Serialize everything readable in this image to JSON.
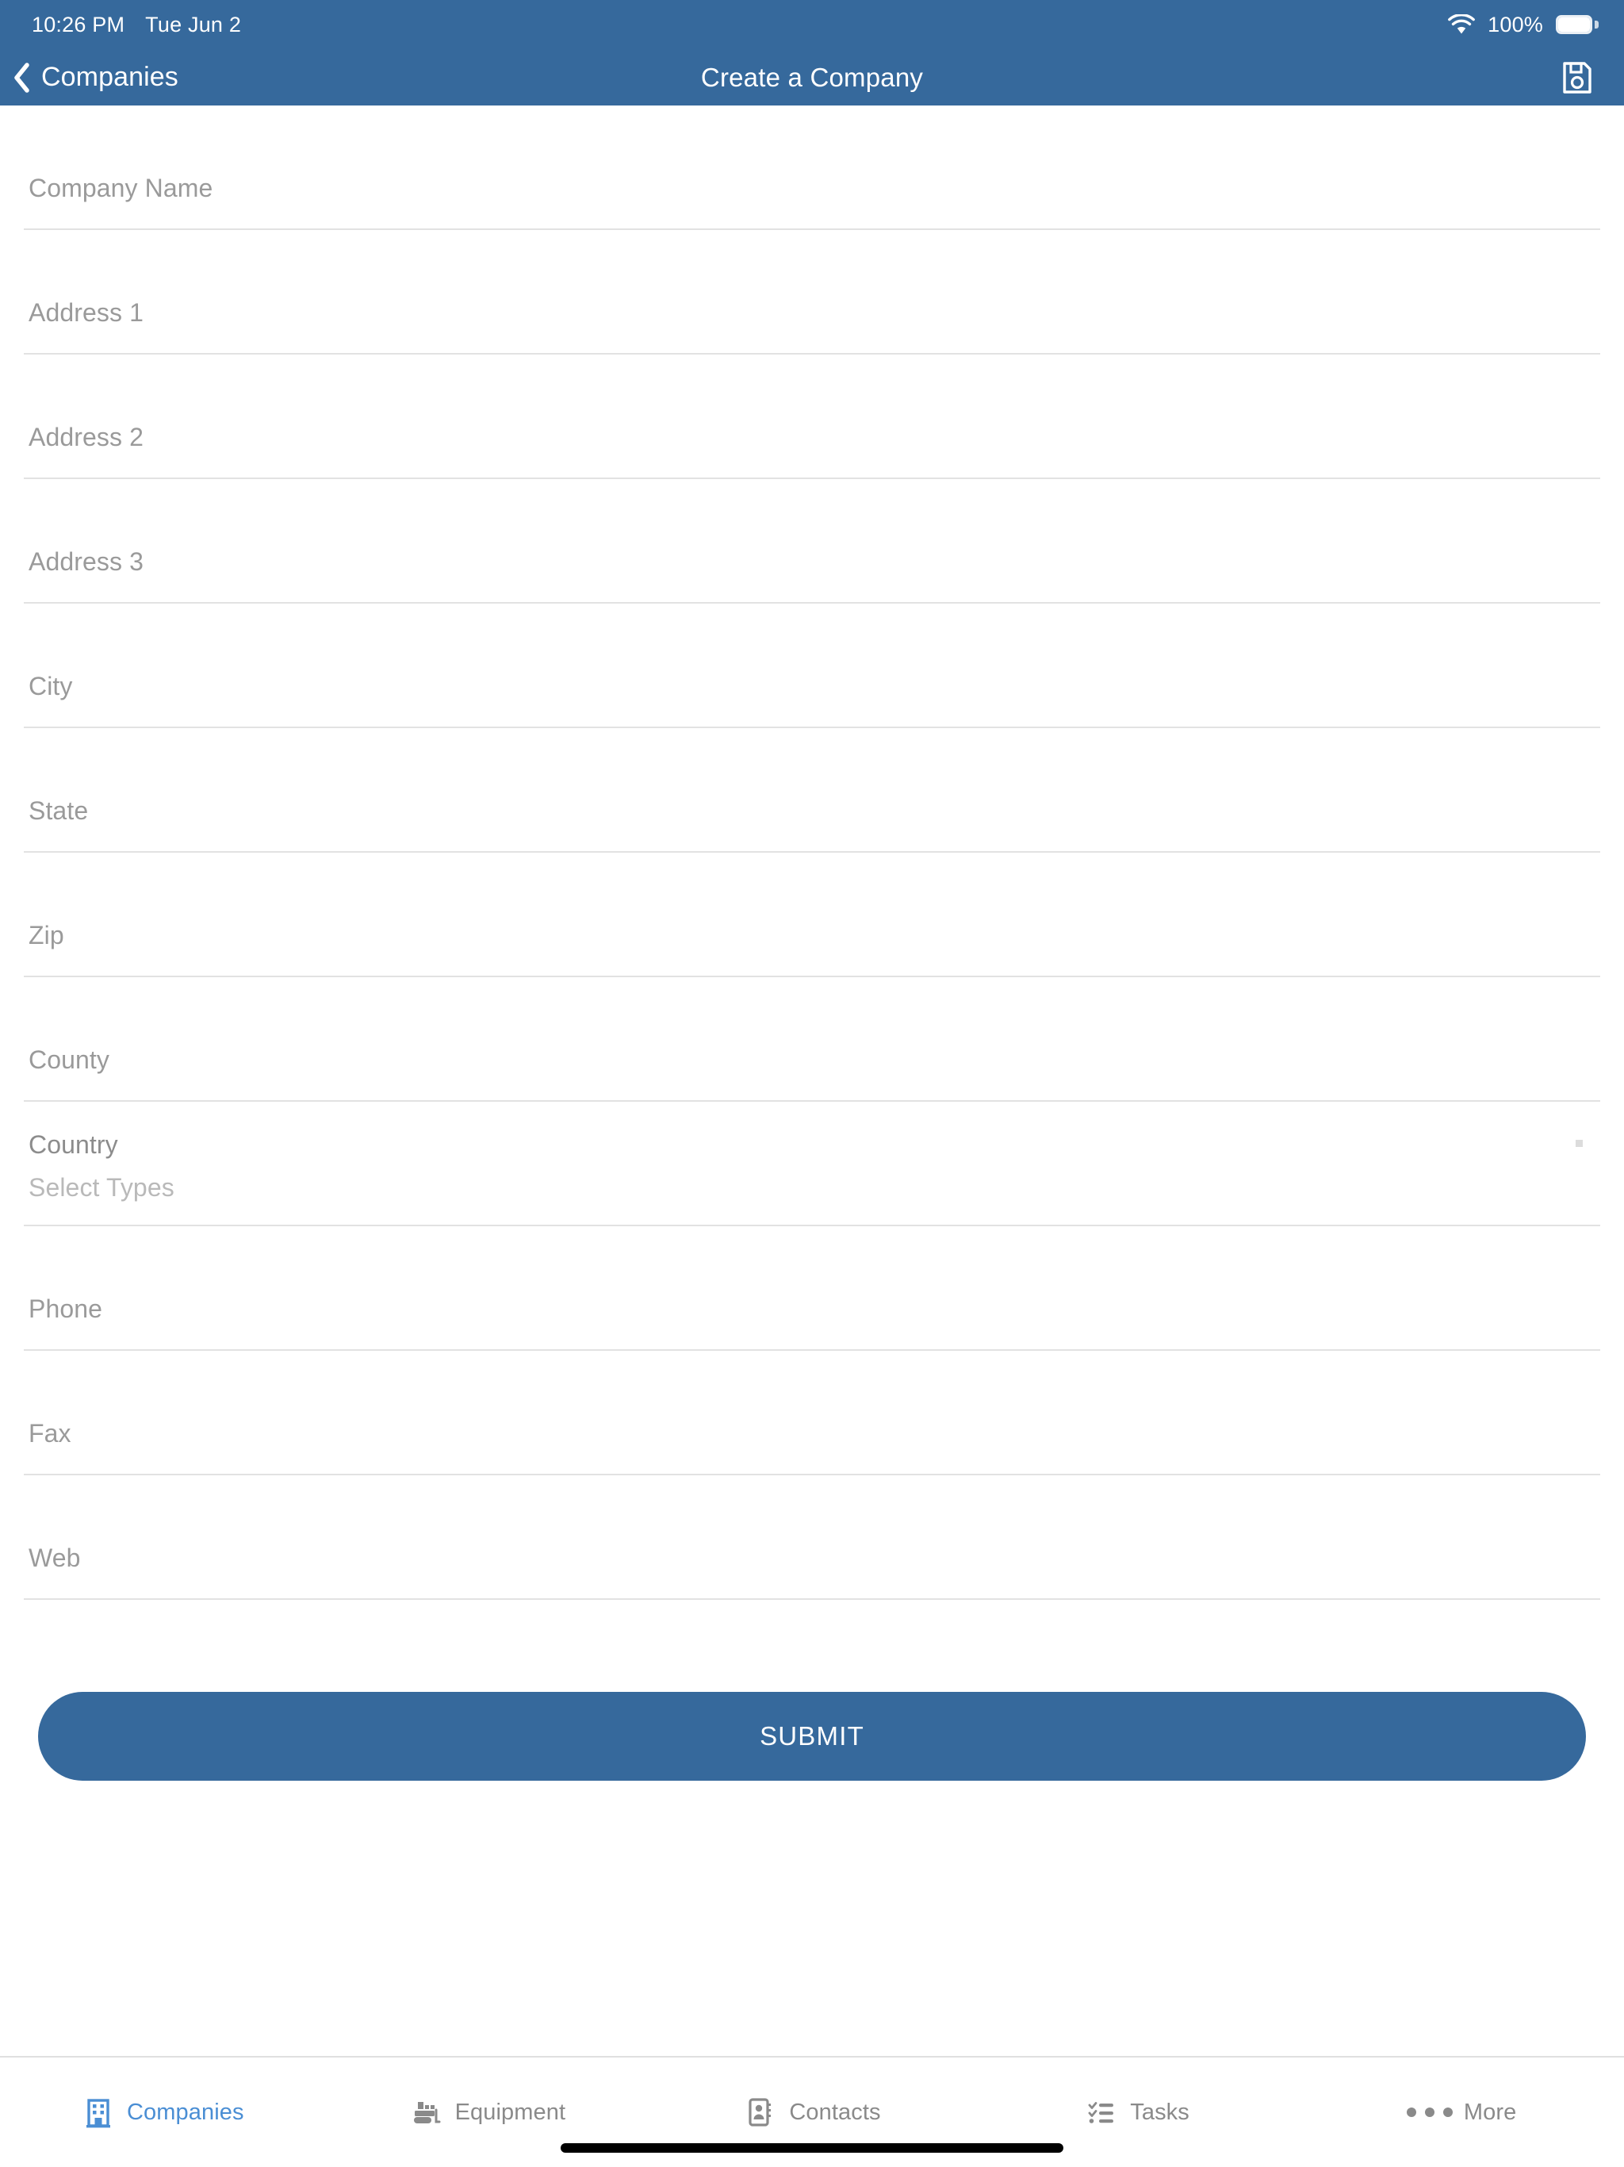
{
  "theme": {
    "brand_blue": "#36699c",
    "active_tab_blue": "#4a8ed4",
    "placeholder_gray": "#9a9a9a",
    "rule_gray": "#e2e2e2",
    "inactive_tab_gray": "#8a8a8a"
  },
  "status_bar": {
    "time": "10:26 PM",
    "date": "Tue Jun 2",
    "wifi_icon": "wifi-icon",
    "battery_percent": "100%",
    "battery_icon": "battery-full-icon"
  },
  "nav_bar": {
    "back_icon": "chevron-left-icon",
    "back_label": "Companies",
    "title": "Create a Company",
    "save_icon": "floppy-disk-save-icon"
  },
  "form": {
    "fields": [
      {
        "name": "company-name",
        "placeholder": "Company Name",
        "value": ""
      },
      {
        "name": "address-1",
        "placeholder": "Address 1",
        "value": ""
      },
      {
        "name": "address-2",
        "placeholder": "Address 2",
        "value": ""
      },
      {
        "name": "address-3",
        "placeholder": "Address 3",
        "value": ""
      },
      {
        "name": "city",
        "placeholder": "City",
        "value": ""
      },
      {
        "name": "state",
        "placeholder": "State",
        "value": ""
      },
      {
        "name": "zip",
        "placeholder": "Zip",
        "value": ""
      },
      {
        "name": "county",
        "placeholder": "County",
        "value": ""
      }
    ],
    "country_row": {
      "label": "Country",
      "types_placeholder": "Select Types",
      "caret_icon": "dropdown-marker-icon"
    },
    "contact_fields": [
      {
        "name": "phone",
        "placeholder": "Phone",
        "value": ""
      },
      {
        "name": "fax",
        "placeholder": "Fax",
        "value": ""
      },
      {
        "name": "web",
        "placeholder": "Web",
        "value": ""
      }
    ],
    "submit_label": "SUBMIT"
  },
  "tab_bar": {
    "tabs": [
      {
        "label": "Companies",
        "icon": "building-icon",
        "active": true
      },
      {
        "label": "Equipment",
        "icon": "bulldozer-icon",
        "active": false
      },
      {
        "label": "Contacts",
        "icon": "address-book-icon",
        "active": false
      },
      {
        "label": "Tasks",
        "icon": "checklist-icon",
        "active": false
      },
      {
        "label": "More",
        "icon": "ellipsis-icon",
        "active": false
      }
    ]
  }
}
